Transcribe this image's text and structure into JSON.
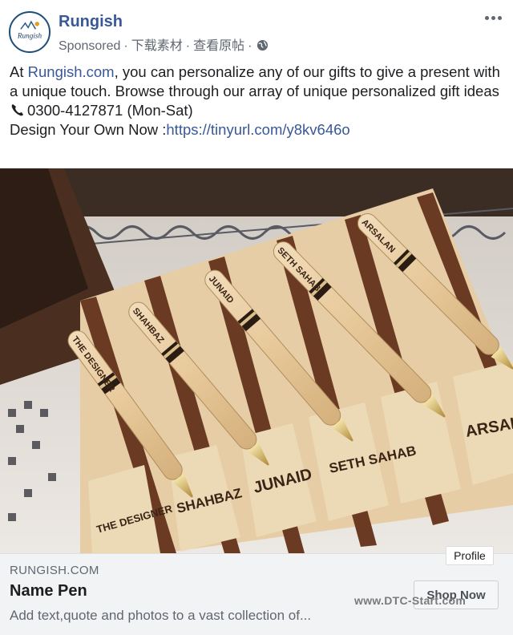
{
  "post": {
    "page_name": "Rungish",
    "sponsored": "Sponsored",
    "meta_download": "下载素材",
    "meta_view": "查看原帖",
    "avatar_text": "Rungish",
    "text_intro_prefix": "At ",
    "text_link_site": "Rungish.com",
    "text_intro_rest": ", you can personalize any of our gifts to give a present with a unique touch. Browse through our array of unique personalized gift ideas",
    "phone": "0300-4127871 (Mon-Sat)",
    "design_prefix": "Design Your Own Now :",
    "design_link": "https://tinyurl.com/y8kv646o"
  },
  "image": {
    "pen_names": [
      "THE DESIGNER",
      "SHAHBAZ",
      "JUNAID",
      "SETH SAHAB",
      "ARSALAN"
    ],
    "block_names": [
      "THE DESIGNER",
      "SHAHBAZ",
      "JUNAID",
      "SETH SAHAB",
      "ARSAL"
    ]
  },
  "link": {
    "domain": "RUNGISH.COM",
    "title": "Name Pen",
    "description": "Add text,quote and photos to a vast collection of...",
    "button": "Shop Now",
    "profile_tag": "Profile",
    "watermark": "www.DTC-Start.com"
  },
  "colors": {
    "link_blue": "#385898",
    "wood_light": "#e6cda5",
    "wood_dark": "#6b3a22"
  }
}
